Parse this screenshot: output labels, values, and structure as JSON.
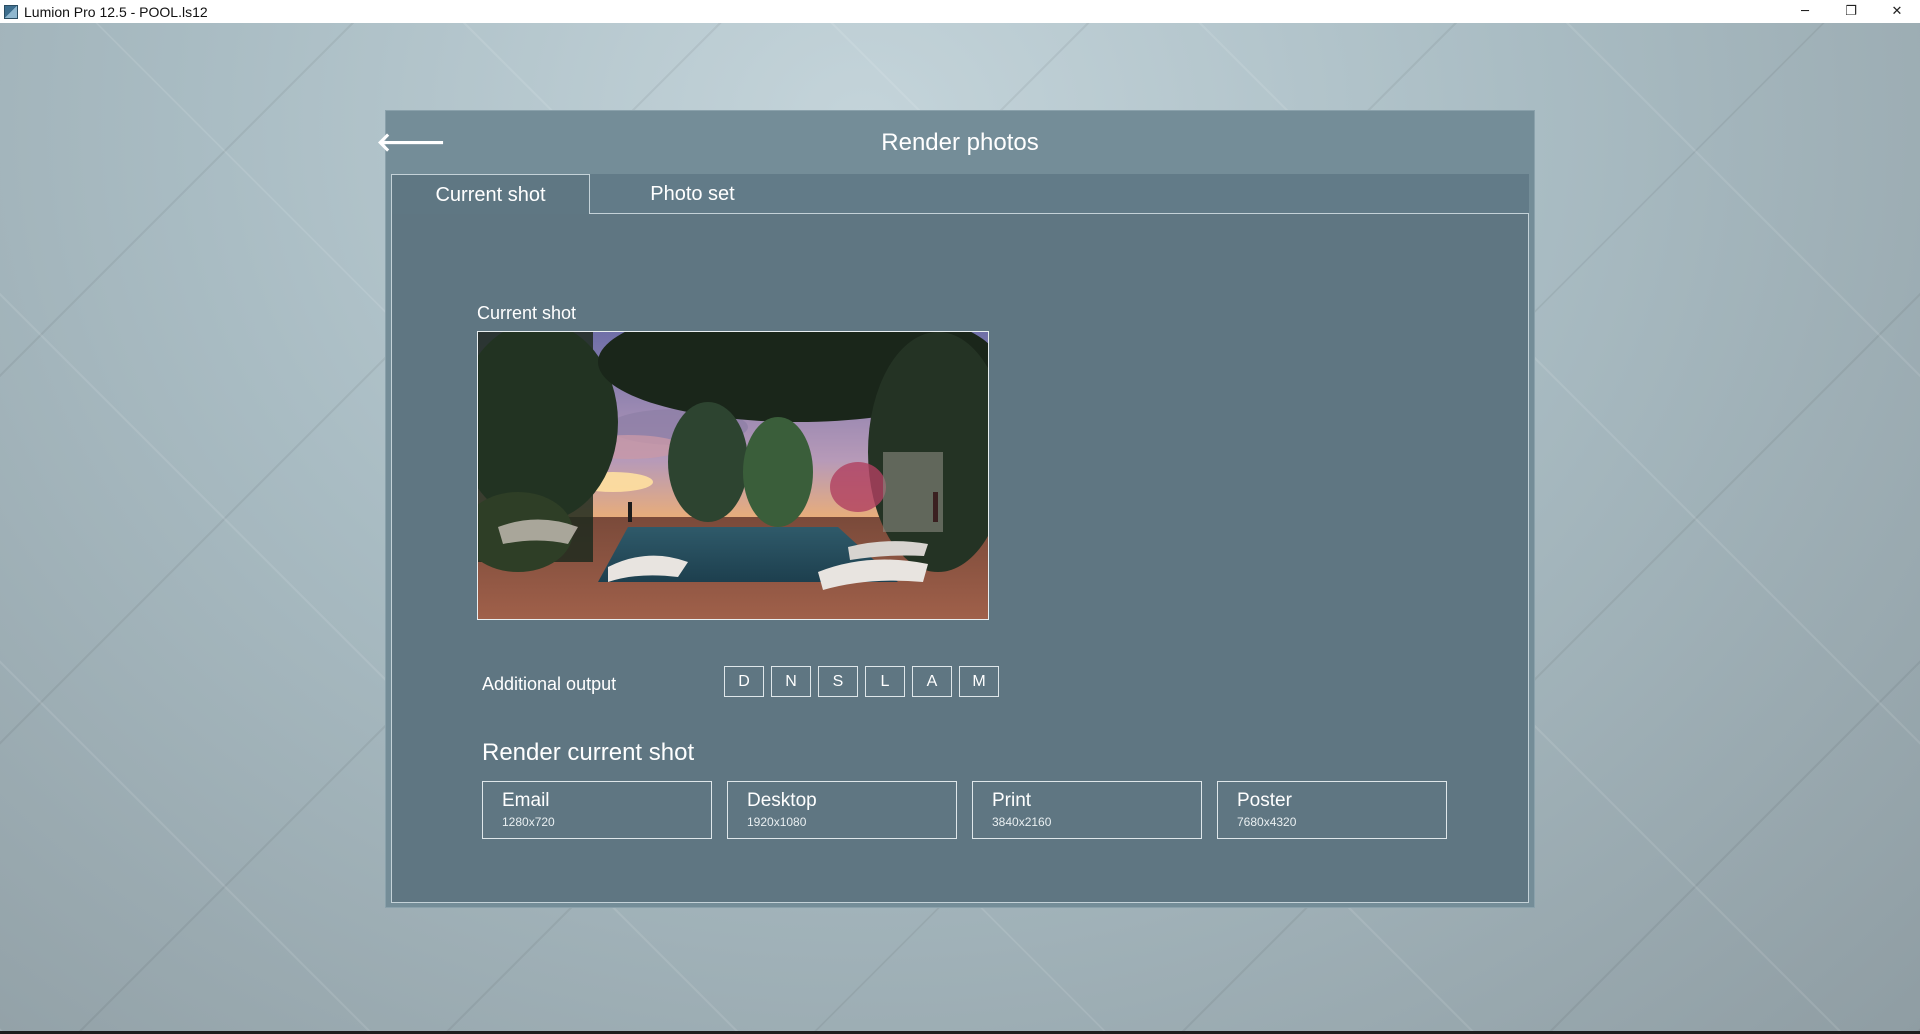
{
  "window": {
    "title": "Lumion Pro 12.5 - POOL.ls12",
    "minimize_glyph": "─",
    "restore_glyph": "❐",
    "close_glyph": "✕"
  },
  "dialog": {
    "title": "Render photos",
    "back_glyph": "🡐"
  },
  "tabs": [
    {
      "label": "Current shot",
      "active": true
    },
    {
      "label": "Photo set",
      "active": false
    }
  ],
  "preview": {
    "label": "Current shot"
  },
  "additional_output": {
    "label": "Additional output",
    "passes": [
      "D",
      "N",
      "S",
      "L",
      "A",
      "M"
    ]
  },
  "render": {
    "heading": "Render current shot",
    "sizes": [
      {
        "name": "Email",
        "resolution": "1280x720"
      },
      {
        "name": "Desktop",
        "resolution": "1920x1080"
      },
      {
        "name": "Print",
        "resolution": "3840x2160"
      },
      {
        "name": "Poster",
        "resolution": "7680x4320"
      }
    ]
  },
  "colors": {
    "dialog_bg": "#748d98",
    "content_bg": "#5f7682",
    "text": "#ffffff"
  }
}
